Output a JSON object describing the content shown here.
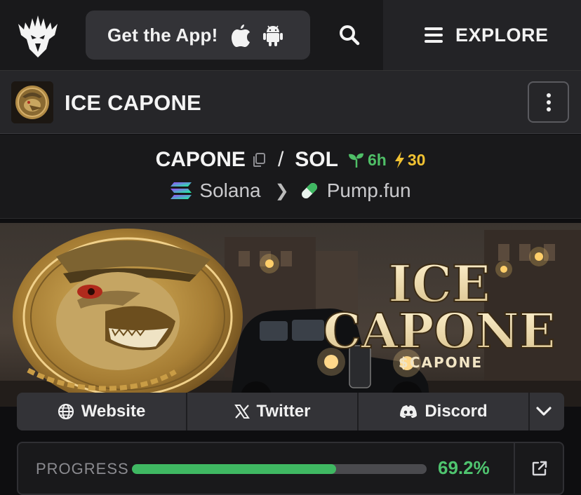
{
  "nav": {
    "get_app_label": "Get the App!",
    "explore_label": "EXPLORE"
  },
  "token": {
    "name": "ICE CAPONE"
  },
  "pair": {
    "base": "CAPONE",
    "separator": "/",
    "quote": "SOL",
    "age": "6h",
    "boosts": "30",
    "chain": "Solana",
    "dex": "Pump.fun"
  },
  "banner": {
    "title_line1": "ICE",
    "title_line2": "CAPONE",
    "ticker": "$CAPONE"
  },
  "socials": {
    "website": "Website",
    "twitter": "Twitter",
    "discord": "Discord"
  },
  "progress": {
    "label": "PROGRESS",
    "value_text": "69.2%",
    "fraction": 0.692
  },
  "colors": {
    "accent_green": "#4fc46f",
    "boost_yellow": "#f1c232",
    "background": "#0e0e10"
  },
  "icons": {
    "logo": "eagle-logo-icon",
    "apple": "apple-icon",
    "android": "android-icon",
    "search": "search-icon",
    "menu": "hamburger-menu-icon",
    "more": "more-vertical-icon",
    "copy": "copy-icon",
    "age": "seedling-icon",
    "boost": "lightning-icon",
    "chain": "solana-icon",
    "dex": "pill-icon",
    "globe": "globe-icon",
    "x": "x-logo-icon",
    "discord": "discord-icon",
    "expand": "chevron-down-icon",
    "external": "external-link-icon"
  }
}
